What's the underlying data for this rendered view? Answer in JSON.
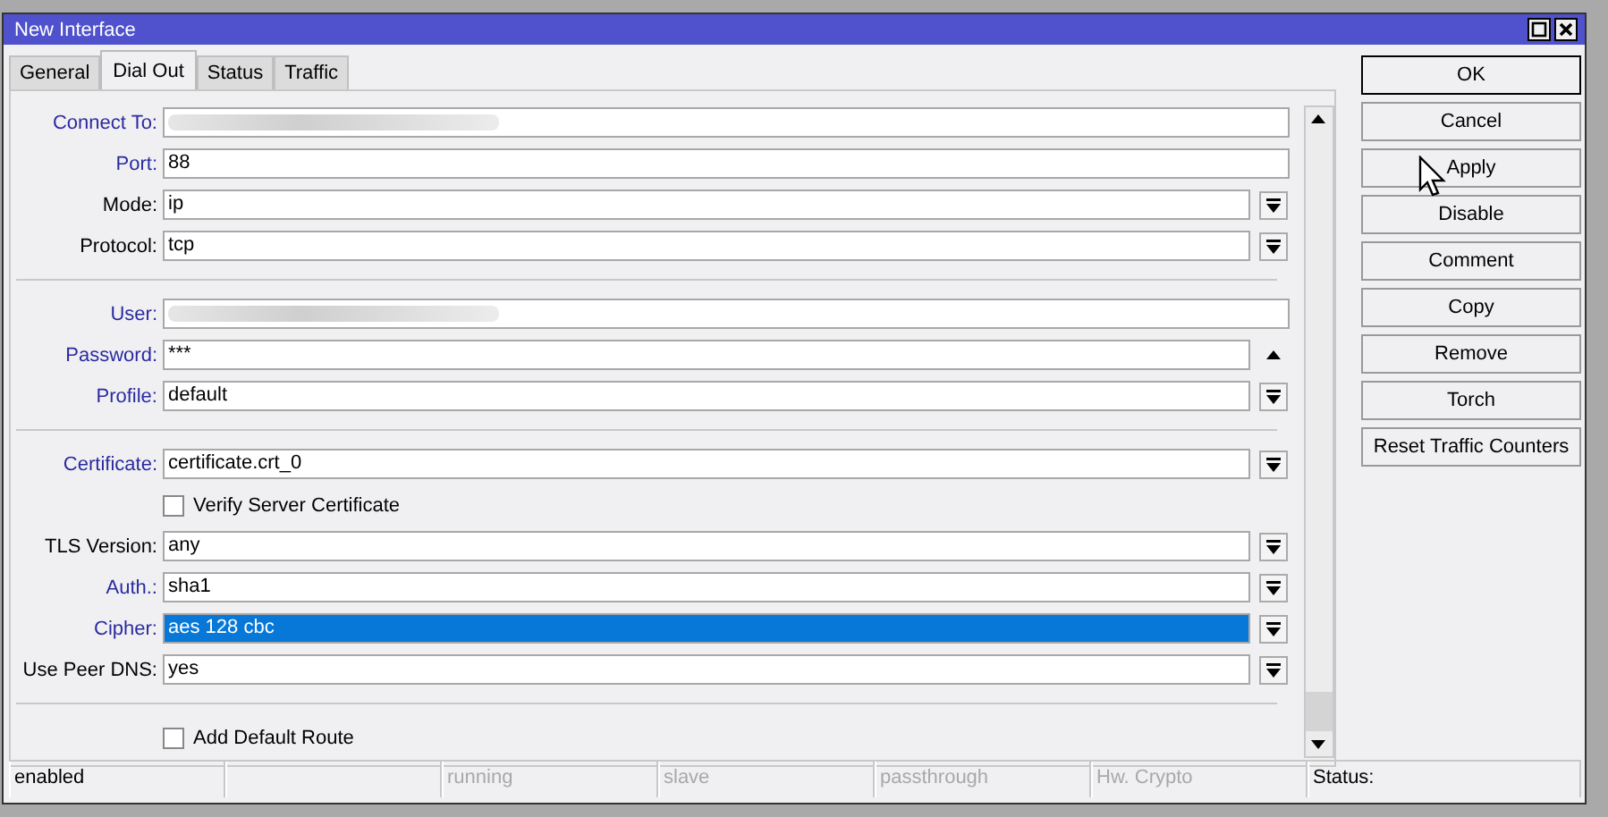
{
  "window": {
    "title": "New Interface"
  },
  "tabs": [
    {
      "label": "General",
      "selected": false
    },
    {
      "label": "Dial Out",
      "selected": true
    },
    {
      "label": "Status",
      "selected": false
    },
    {
      "label": "Traffic",
      "selected": false
    }
  ],
  "fields": [
    {
      "kind": "text",
      "label": "Connect To:",
      "required": true,
      "redacted": true
    },
    {
      "kind": "text",
      "label": "Port:",
      "required": true,
      "value": "88"
    },
    {
      "kind": "select",
      "label": "Mode:",
      "required": false,
      "value": "ip"
    },
    {
      "kind": "select",
      "label": "Protocol:",
      "required": false,
      "value": "tcp"
    },
    {
      "kind": "divider"
    },
    {
      "kind": "text",
      "label": "User:",
      "required": true,
      "redacted": true
    },
    {
      "kind": "password",
      "label": "Password:",
      "required": true,
      "value": "***"
    },
    {
      "kind": "select",
      "label": "Profile:",
      "required": true,
      "value": "default"
    },
    {
      "kind": "divider"
    },
    {
      "kind": "select",
      "label": "Certificate:",
      "required": true,
      "value": "certificate.crt_0"
    },
    {
      "kind": "checkbox",
      "label": "Verify Server Certificate",
      "checked": false
    },
    {
      "kind": "select",
      "label": "TLS Version:",
      "required": false,
      "value": "any"
    },
    {
      "kind": "select",
      "label": "Auth.:",
      "required": true,
      "value": "sha1"
    },
    {
      "kind": "select",
      "label": "Cipher:",
      "required": true,
      "value": "aes 128 cbc",
      "highlighted": true
    },
    {
      "kind": "select",
      "label": "Use Peer DNS:",
      "required": false,
      "value": "yes"
    },
    {
      "kind": "divider"
    },
    {
      "kind": "checkbox",
      "label": "Add Default Route",
      "checked": false
    }
  ],
  "buttons": [
    {
      "label": "OK",
      "default": true
    },
    {
      "label": "Cancel",
      "default": false
    },
    {
      "label": "Apply",
      "default": false
    },
    {
      "label": "Disable",
      "default": false
    },
    {
      "label": "Comment",
      "default": false
    },
    {
      "label": "Copy",
      "default": false
    },
    {
      "label": "Remove",
      "default": false
    },
    {
      "label": "Torch",
      "default": false
    },
    {
      "label": "Reset Traffic Counters",
      "default": false
    }
  ],
  "status_bar": [
    {
      "kind": "text",
      "text": "enabled",
      "disabled": false
    },
    {
      "kind": "empty"
    },
    {
      "kind": "text",
      "text": "running",
      "disabled": true
    },
    {
      "kind": "text",
      "text": "slave",
      "disabled": true
    },
    {
      "kind": "text",
      "text": "passthrough",
      "disabled": true
    },
    {
      "kind": "text",
      "text": "Hw. Crypto",
      "disabled": true
    },
    {
      "kind": "text",
      "text": "Status:",
      "disabled": false
    }
  ]
}
